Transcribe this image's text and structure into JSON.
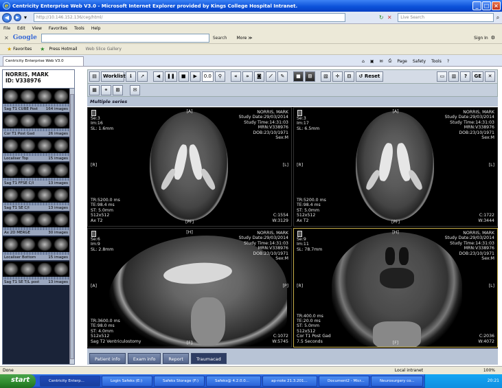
{
  "window": {
    "title": "Centricity Enterprise Web V3.0 - Microsoft Internet Explorer provided by Kings College Hospital Intranet."
  },
  "address": {
    "url": "http://10.146.152.136/ceg/html/",
    "search_placeholder": "Live Search"
  },
  "menu": [
    "File",
    "Edit",
    "View",
    "Favorites",
    "Tools",
    "Help"
  ],
  "google": {
    "logo": "Google",
    "search_label": "Search",
    "more_label": "More ≫",
    "signin_label": "Sign In"
  },
  "favorites": {
    "label": "Favorites",
    "items": [
      "Press Hotmail",
      "Web Slice Gallery"
    ]
  },
  "tab": {
    "title": "Centricity Enterprise Web V3.0"
  },
  "ie_commands": [
    "Page",
    "Safety",
    "Tools"
  ],
  "patient": {
    "name": "NORRIS, MARK",
    "id": "ID: V338976"
  },
  "thumbnails": [
    {
      "label": "Sag T1 CUBE Post",
      "count": "164 images"
    },
    {
      "label": "Cor T1 Post Gad",
      "count": "26 images"
    },
    {
      "label": "Localiser Top",
      "count": "15 images"
    },
    {
      "label": "Sag T1 FFSE C/I",
      "count": "13 images"
    },
    {
      "label": "Sag T1 SE C/I",
      "count": "13 images"
    },
    {
      "label": "Ax 2D MERGE",
      "count": "30 images"
    },
    {
      "label": "Localiser Bottom",
      "count": "15 images"
    },
    {
      "label": "Sag T1 SE T/L post",
      "count": "13 images"
    }
  ],
  "toolbar": {
    "worklist_label": "Worklist",
    "zoom_value": "0.0",
    "reset_label": "Reset"
  },
  "viewer": {
    "series_title": "Multiple series"
  },
  "panels": [
    {
      "tl": [
        "Se:3",
        "Im:16",
        "SL: 1.6mm"
      ],
      "tr": [
        "NORRIS, MARK",
        "Study Date:29/03/2014",
        "Study Time:14:31:03",
        "MRN:V338976",
        "DOB:23/10/1971",
        "Sex:M"
      ],
      "bl": [
        "TR:5200.0 ms",
        "TE:98.4 ms",
        "ST: 5.0mm",
        "512x512",
        "Ax T2"
      ],
      "br": [
        "C:1554",
        "W:3129"
      ],
      "top": "[A]",
      "left": "[R]",
      "right": "[L]",
      "bottom": "[PF]"
    },
    {
      "tl": [
        "Se:3",
        "Im:17",
        "SL: 6.5mm"
      ],
      "tr": [
        "NORRIS, MARK",
        "Study Date:29/03/2014",
        "Study Time:14:31:03",
        "MRN:V338976",
        "DOB:23/10/1971",
        "Sex:M"
      ],
      "bl": [
        "TR:5200.0 ms",
        "TE:98.4 ms",
        "ST: 5.0mm",
        "512x512",
        "Ax T2"
      ],
      "br": [
        "C:1722",
        "W:3444"
      ],
      "top": "[A]",
      "left": "[R]",
      "right": "[L]",
      "bottom": "[PF]"
    },
    {
      "tl": [
        "Se:6",
        "Im:9",
        "SL: 2.8mm"
      ],
      "tr": [
        "NORRIS, MARK",
        "Study Date:29/03/2014",
        "Study Time:14:31:03",
        "MRN:V338976",
        "DOB:23/10/1971",
        "Sex:M"
      ],
      "bl": [
        "TR:3600.0 ms",
        "TE:98.0 ms",
        "ST: 4.0mm",
        "512x512",
        "Sag T2 Ventriculostomy"
      ],
      "br": [
        "C:1072",
        "W:5745"
      ],
      "top": "[H]",
      "left": "[A]",
      "right": "[P]",
      "bottom": "[F]"
    },
    {
      "tl": [
        "Se:9",
        "Im:11",
        "SL: 78.7mm"
      ],
      "tr": [
        "NORRIS, MARK",
        "Study Date:29/03/2014",
        "Study Time:14:31:03",
        "MRN:V338976",
        "DOB:23/10/1971",
        "Sex:M"
      ],
      "bl": [
        "TR:400.0 ms",
        "TE:20.0 ms",
        "ST: 5.0mm",
        "512x512",
        "Cor T1 Post Gad",
        "7.5 Seconds"
      ],
      "br": [
        "C:2036",
        "W:4072"
      ],
      "top": "[H]",
      "left": "[R]",
      "right": "[L]",
      "bottom": "[F]"
    }
  ],
  "bottom_tabs": [
    "Patient info",
    "Exam info",
    "Report",
    "Traumacad"
  ],
  "status": {
    "left": "Done",
    "zone": "Local intranet",
    "zoom": "100%"
  },
  "taskbar": {
    "start": "start",
    "tasks": [
      "Centricity Enterp...",
      "Login Safeks (E:)",
      "Safeks Storage (F:)",
      "Safeks@ 4.2.0.0...",
      "ap-note 21.3.201...",
      "Document2 - Micr...",
      "Neurosurgery co..."
    ],
    "clock": "20:21"
  }
}
